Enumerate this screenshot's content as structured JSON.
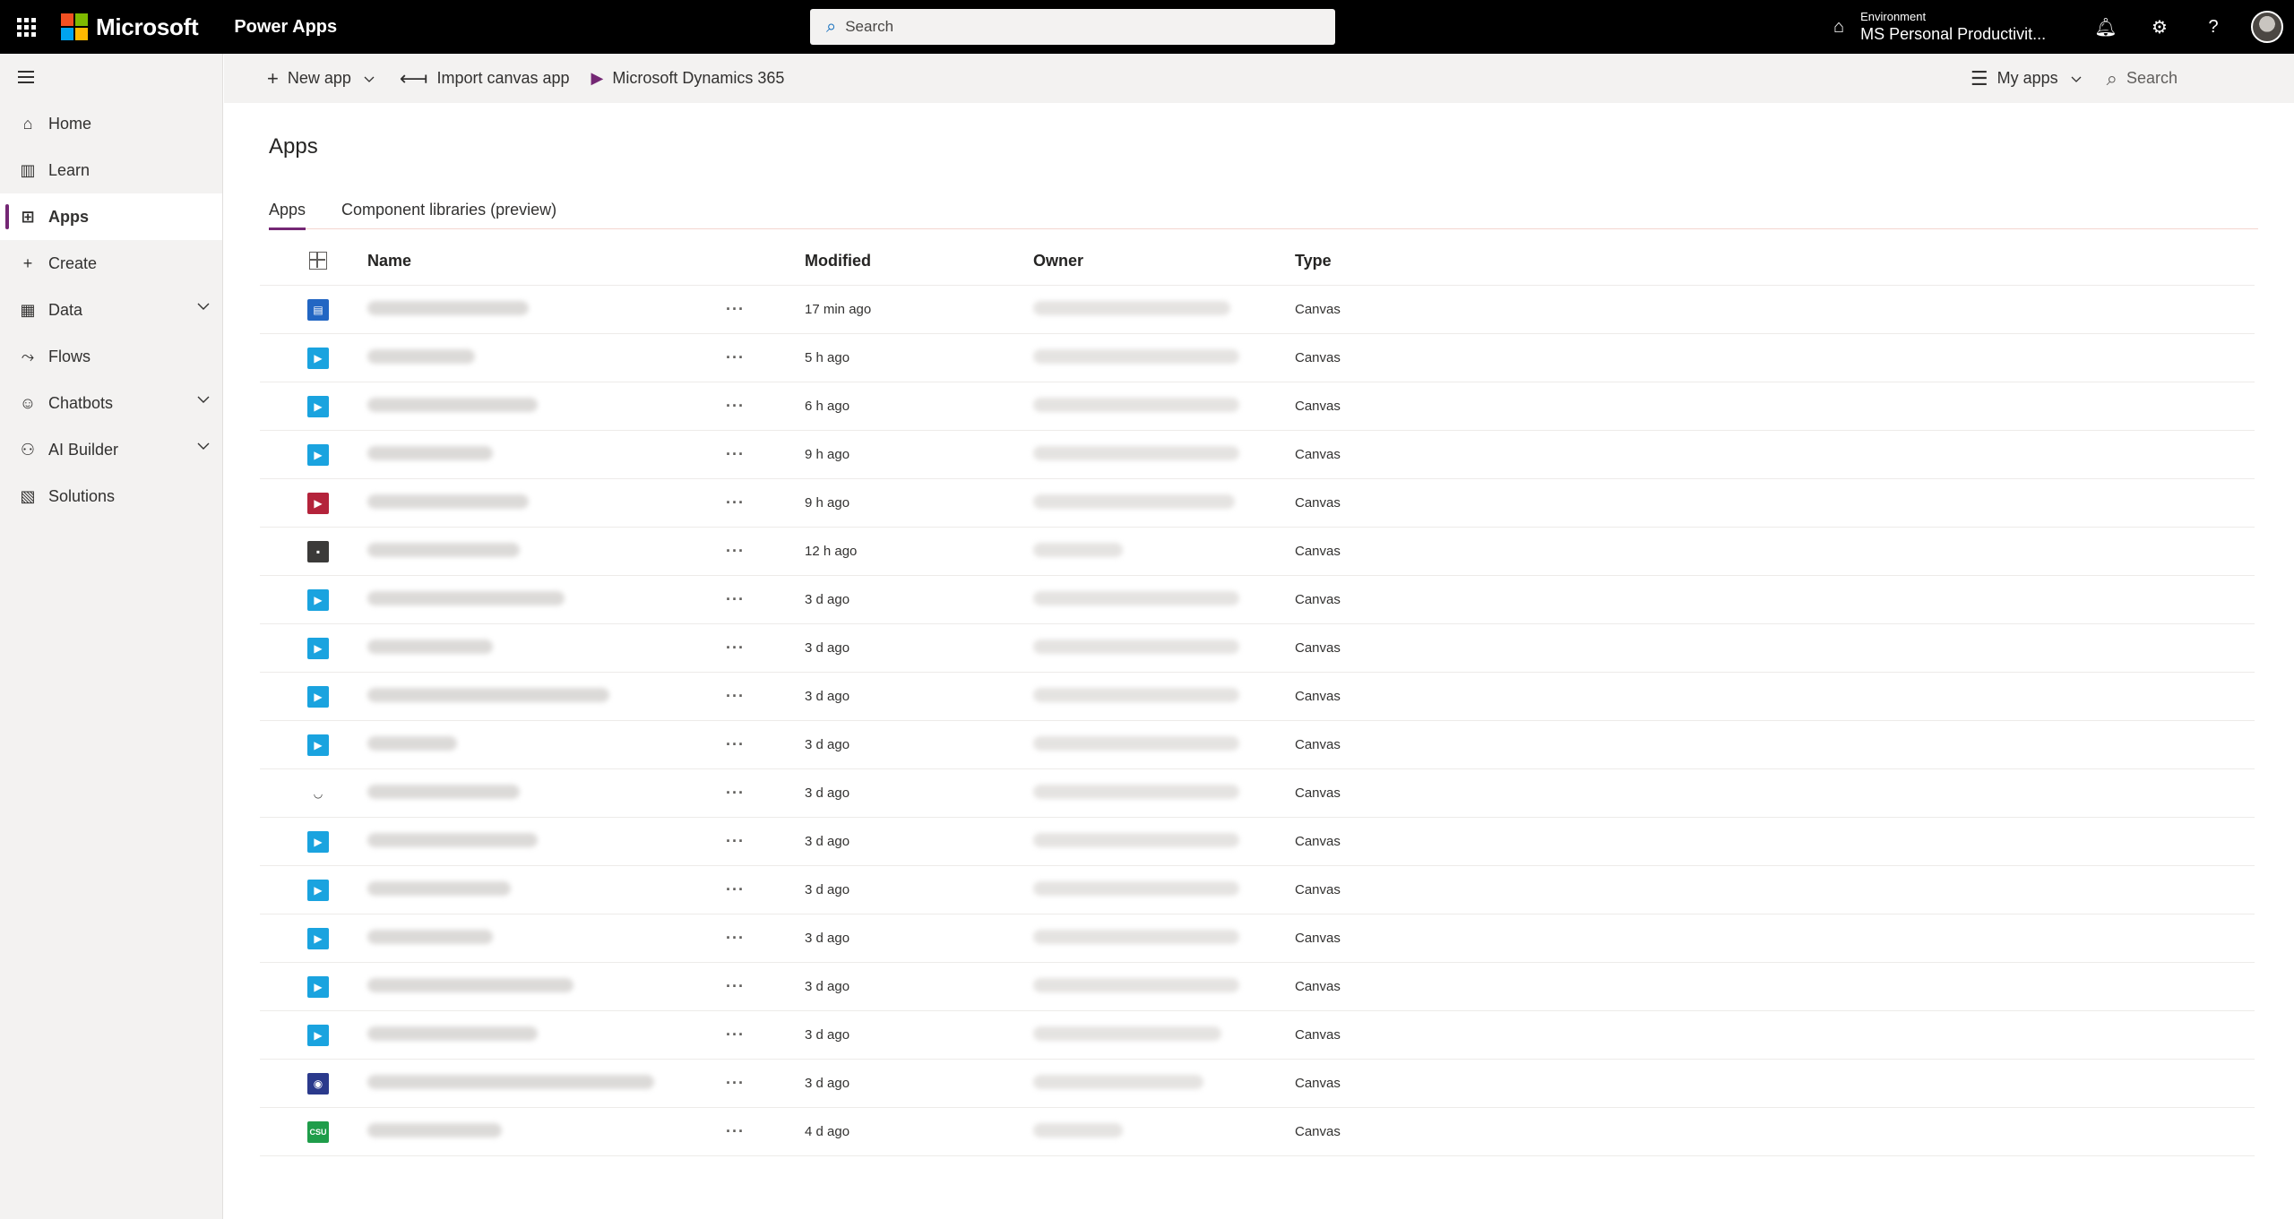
{
  "header": {
    "brand": "Microsoft",
    "app_name": "Power Apps",
    "search_placeholder": "Search",
    "environment_label": "Environment",
    "environment_value": "MS Personal Productivit...",
    "logo_colors": [
      "#f25022",
      "#7fba00",
      "#00a4ef",
      "#ffb900"
    ]
  },
  "sidebar": {
    "items": [
      {
        "label": "Home",
        "icon": "home-icon"
      },
      {
        "label": "Learn",
        "icon": "book-icon"
      },
      {
        "label": "Apps",
        "icon": "apps-icon",
        "active": true
      },
      {
        "label": "Create",
        "icon": "plus-icon"
      },
      {
        "label": "Data",
        "icon": "table-icon",
        "expandable": true
      },
      {
        "label": "Flows",
        "icon": "flow-icon"
      },
      {
        "label": "Chatbots",
        "icon": "bot-icon",
        "expandable": true
      },
      {
        "label": "AI Builder",
        "icon": "ai-icon",
        "expandable": true
      },
      {
        "label": "Solutions",
        "icon": "solutions-icon"
      }
    ]
  },
  "commandbar": {
    "new_app": "New app",
    "import_canvas": "Import canvas app",
    "dynamics": "Microsoft Dynamics 365",
    "filter": "My apps",
    "search": "Search"
  },
  "main": {
    "title": "Apps",
    "tabs": [
      {
        "label": "Apps",
        "active": true
      },
      {
        "label": "Component libraries (preview)"
      }
    ],
    "columns": {
      "name": "Name",
      "modified": "Modified",
      "owner": "Owner",
      "type": "Type"
    },
    "more_label": "···",
    "rows": [
      {
        "modified": "17 min ago",
        "type": "Canvas",
        "icon_color": "#2266c3",
        "icon_glyph": "▤"
      },
      {
        "modified": "5 h ago",
        "type": "Canvas",
        "icon_color": "#1aa3df",
        "icon_glyph": "▶"
      },
      {
        "modified": "6 h ago",
        "type": "Canvas",
        "icon_color": "#1aa3df",
        "icon_glyph": "▶"
      },
      {
        "modified": "9 h ago",
        "type": "Canvas",
        "icon_color": "#1aa3df",
        "icon_glyph": "▶"
      },
      {
        "modified": "9 h ago",
        "type": "Canvas",
        "icon_color": "#b4233b",
        "icon_glyph": "▶"
      },
      {
        "modified": "12 h ago",
        "type": "Canvas",
        "icon_color": "#3b3a39",
        "icon_glyph": "▪"
      },
      {
        "modified": "3 d ago",
        "type": "Canvas",
        "icon_color": "#1aa3df",
        "icon_glyph": "▶"
      },
      {
        "modified": "3 d ago",
        "type": "Canvas",
        "icon_color": "#1aa3df",
        "icon_glyph": "▶"
      },
      {
        "modified": "3 d ago",
        "type": "Canvas",
        "icon_color": "#1aa3df",
        "icon_glyph": "▶"
      },
      {
        "modified": "3 d ago",
        "type": "Canvas",
        "icon_color": "#1aa3df",
        "icon_glyph": "▶"
      },
      {
        "modified": "3 d ago",
        "type": "Canvas",
        "icon_color": "#ffffff",
        "icon_glyph": "◡"
      },
      {
        "modified": "3 d ago",
        "type": "Canvas",
        "icon_color": "#1aa3df",
        "icon_glyph": "▶"
      },
      {
        "modified": "3 d ago",
        "type": "Canvas",
        "icon_color": "#1aa3df",
        "icon_glyph": "▶"
      },
      {
        "modified": "3 d ago",
        "type": "Canvas",
        "icon_color": "#1aa3df",
        "icon_glyph": "▶"
      },
      {
        "modified": "3 d ago",
        "type": "Canvas",
        "icon_color": "#1aa3df",
        "icon_glyph": "▶"
      },
      {
        "modified": "3 d ago",
        "type": "Canvas",
        "icon_color": "#1aa3df",
        "icon_glyph": "▶"
      },
      {
        "modified": "3 d ago",
        "type": "Canvas",
        "icon_color": "#2b3a8c",
        "icon_glyph": "◉"
      },
      {
        "modified": "4 d ago",
        "type": "Canvas",
        "icon_color": "#1f9d4a",
        "icon_glyph": "CSU"
      }
    ]
  }
}
